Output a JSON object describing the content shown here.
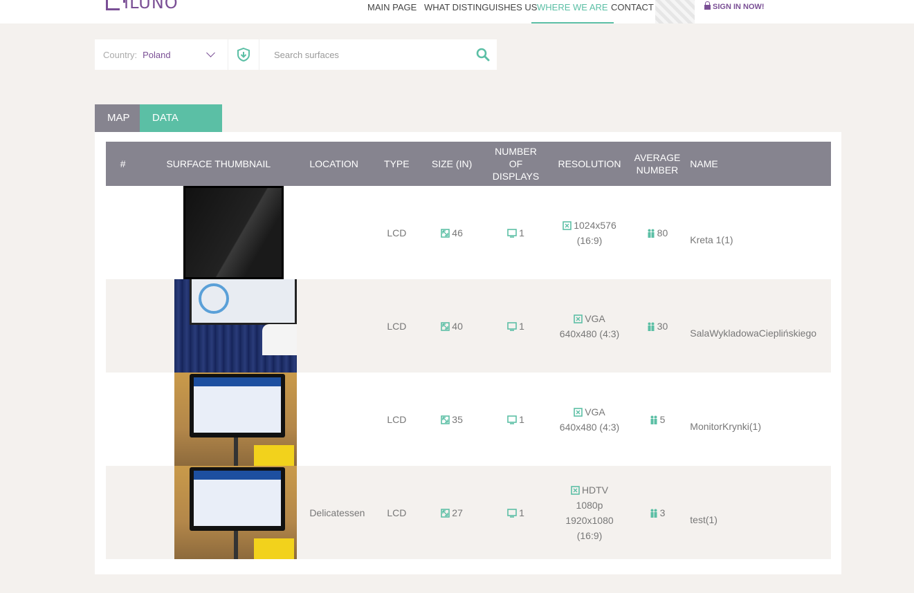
{
  "header": {
    "logo_text": "ILUNO",
    "nav": [
      {
        "label": "MAIN PAGE",
        "active": false
      },
      {
        "label": "WHAT DISTINGUISHES US",
        "active": false
      },
      {
        "label": "WHERE WE ARE",
        "active": true
      },
      {
        "label": "CONTACT",
        "active": false
      }
    ],
    "signin_label": "SIGN IN NOW!"
  },
  "filter": {
    "country_label": "Country:",
    "country_value": "Poland",
    "search_placeholder": "Search surfaces"
  },
  "tabs": [
    {
      "label": "MAP",
      "active": false
    },
    {
      "label": "DATA TABLE",
      "active": true
    }
  ],
  "table": {
    "columns": [
      "#",
      "SURFACE THUMBNAIL",
      "LOCATION",
      "TYPE",
      "SIZE (IN)",
      "NUMBER OF DISPLAYS",
      "RESOLUTION",
      "AVERAGE NUMBER",
      "NAME"
    ],
    "rows": [
      {
        "number": "",
        "thumbnail": "tv",
        "location": "",
        "type": "LCD",
        "size": "46",
        "displays": "1",
        "resolution": "1024x576 (16:9)",
        "average": "80",
        "name": "Kreta 1(1)"
      },
      {
        "number": "",
        "thumbnail": "room",
        "location": "",
        "type": "LCD",
        "size": "40",
        "displays": "1",
        "resolution": "VGA 640x480 (4:3)",
        "average": "30",
        "name": "SalaWykladowaCieplińskiego"
      },
      {
        "number": "",
        "thumbnail": "faz",
        "location": "",
        "type": "LCD",
        "size": "35",
        "displays": "1",
        "resolution": "VGA 640x480 (4:3)",
        "average": "5",
        "name": "MonitorKrynki(1)"
      },
      {
        "number": "",
        "thumbnail": "faz",
        "location": "Delicatessen",
        "type": "LCD",
        "size": "27",
        "displays": "1",
        "resolution": "HDTV 1080p 1920x1080 (16:9)",
        "average": "3",
        "name": "test(1)"
      }
    ]
  },
  "colors": {
    "accent": "#5bbfa5",
    "brand": "#7a4f95",
    "header_bg": "#86848f",
    "page_bg": "#f4f1ee"
  }
}
